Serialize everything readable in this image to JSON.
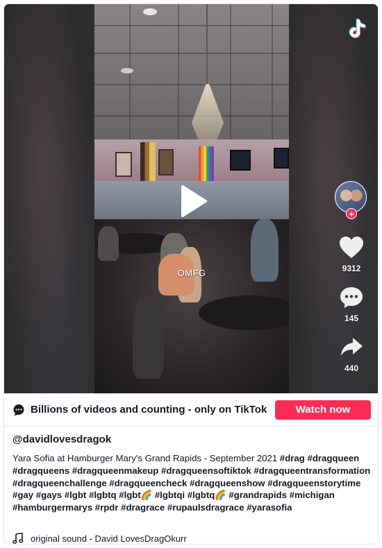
{
  "video": {
    "caption_overlay": "OMFG"
  },
  "sidebar": {
    "likes": "9312",
    "comments": "145",
    "shares": "440"
  },
  "promo": {
    "text": "Billions of videos and counting - only on TikTok",
    "button_label": "Watch now"
  },
  "author": {
    "username": "@davidlovesdragok"
  },
  "description": {
    "intro": "Yara Sofia at Hamburger Mary's Grand Rapids - September 2021 ",
    "hashtags": [
      "#drag",
      "#dragqueen",
      "#dragqueens",
      "#dragqueenmakeup",
      "#dragqueensoftiktok",
      "#dragqueentransformation",
      "#dragqueenchallenge",
      "#dragqueencheck",
      "#dragqueenshow",
      "#dragqueenstorytime",
      "#gay",
      "#gays",
      "#lgbt",
      "#lgbtq",
      "#lgbt🌈",
      "#lgbtqi",
      "#lgbtq🌈",
      "#grandrapids",
      "#michigan",
      "#hamburgermarys",
      "#rpdr",
      "#dragrace",
      "#rupaulsdragrace",
      "#yarasofia"
    ]
  },
  "sound": {
    "label": "original sound - David LovesDragOkurr"
  },
  "colors": {
    "accent": "#fe2c55",
    "text": "#161823",
    "tiktok_cyan": "#25f4ee",
    "tiktok_red": "#fe2c55"
  },
  "icons": {
    "logo": "tiktok-logo-icon",
    "play": "play-icon",
    "like": "heart-icon",
    "comment": "comment-icon",
    "share": "share-arrow-icon",
    "promo": "chat-bubble-icon",
    "sound": "music-note-icon"
  }
}
